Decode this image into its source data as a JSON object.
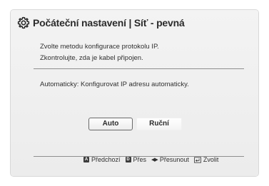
{
  "dialog": {
    "title": "Počáteční nastavení | Síť - pevná",
    "message_line1": "Zvolte metodu konfigurace protokolu IP.",
    "message_line2": "Zkontrolujte, zda je kabel připojen.",
    "auto_description": "Automaticky: Konfigurovat IP adresu automaticky."
  },
  "buttons": {
    "auto_label": "Auto",
    "manual_label": "Ruční"
  },
  "footer": {
    "key_a": "A",
    "previous_label": "Předchozí",
    "key_d": "D",
    "skip_label": "Přes",
    "move_label": "Přesunout",
    "select_label": "Zvolit"
  },
  "icons": {
    "title": "gear-icon",
    "move": "left-right-arrows-icon",
    "select": "enter-icon"
  }
}
